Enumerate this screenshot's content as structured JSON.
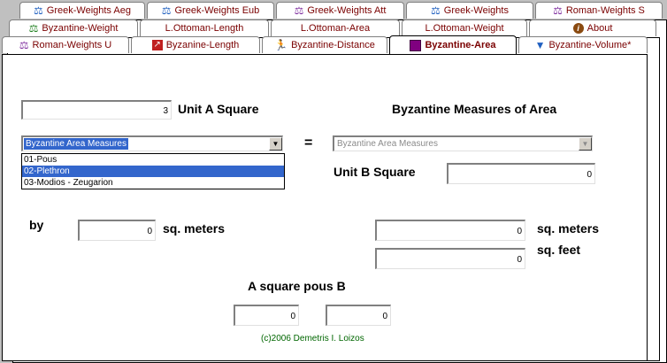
{
  "tabs_row1": [
    {
      "label": "Greek-Weights Aeg",
      "icon": "scale-icon"
    },
    {
      "label": "Greek-Weights Eub",
      "icon": "scale-icon"
    },
    {
      "label": "Greek-Weights Att",
      "icon": "scale-icon"
    },
    {
      "label": "Greek-Weights",
      "icon": "scale-icon"
    },
    {
      "label": "Roman-Weights S",
      "icon": "scale-icon"
    }
  ],
  "tabs_row2": [
    {
      "label": "Byzantine-Weight",
      "icon": "scale-icon"
    },
    {
      "label": "L.Ottoman-Length"
    },
    {
      "label": "L.Ottoman-Area"
    },
    {
      "label": "L.Ottoman-Weight"
    },
    {
      "label": "About",
      "icon": "info-icon"
    }
  ],
  "tabs_row3": [
    {
      "label": "Roman-Weights U",
      "icon": "scale-icon"
    },
    {
      "label": "Byzanine-Length",
      "icon": "ruler-icon"
    },
    {
      "label": "Byzantine-Distance",
      "icon": "runner-icon"
    },
    {
      "label": "Byzantine-Area",
      "icon": "square-icon"
    },
    {
      "label": "Byzantine-Volume*",
      "icon": "funnel-icon"
    }
  ],
  "form": {
    "unit_a_value": "3",
    "unit_a_label": "Unit  A Square",
    "title": "Byzantine Measures of Area",
    "combo_a_value": "Byzantine Area Measures",
    "combo_b_value": "Byzantine Area Measures",
    "equals": "=",
    "unit_b_label": "Unit  B Square",
    "unit_b_value": "0",
    "dropdown_options": [
      "01-Pous",
      "02-Plethron",
      "03-Modios - Zeugarion"
    ],
    "by_label": "by",
    "by_value": "0",
    "sqm_label_left": "sq. meters",
    "result_sqm_value": "0",
    "sqm_label_right": "sq. meters",
    "result_sqft_value": "0",
    "sqft_label": "sq. feet",
    "pous_label": "A   square pous  B",
    "pous_a_value": "0",
    "pous_b_value": "0",
    "copyright": "(c)2006  Demetris I. Loizos"
  }
}
